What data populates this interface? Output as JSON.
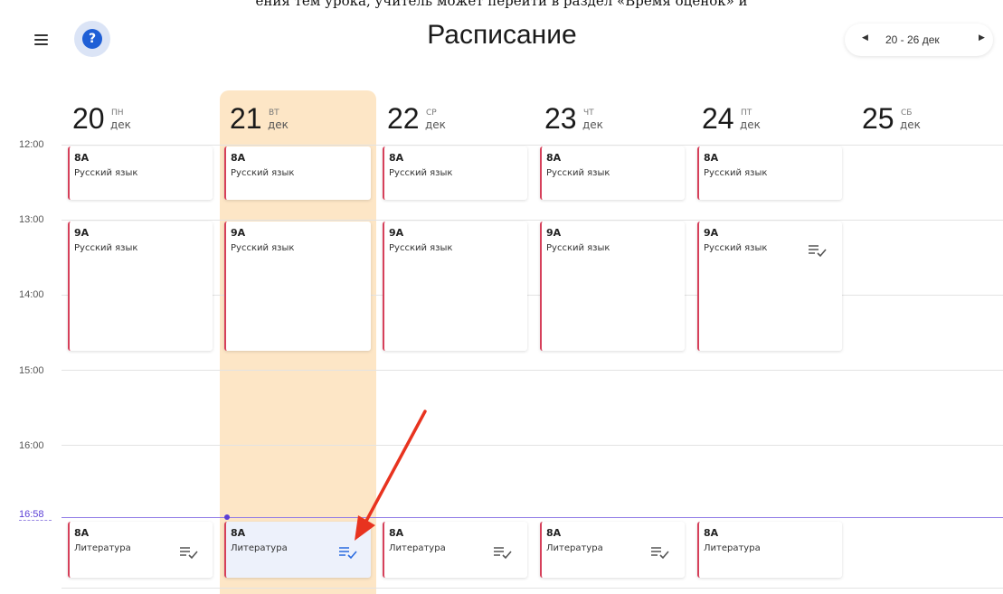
{
  "caption": "ения тем урока, учитель может перейти в раздел «Время оценок» и",
  "header": {
    "title": "Расписание",
    "week_range": "20 - 26 дек",
    "prev": "‹",
    "next": "›",
    "help_glyph": "?"
  },
  "days": [
    {
      "num": "20",
      "weekday": "ПН",
      "month": "дек"
    },
    {
      "num": "21",
      "weekday": "ВТ",
      "month": "дек"
    },
    {
      "num": "22",
      "weekday": "СР",
      "month": "дек"
    },
    {
      "num": "23",
      "weekday": "ЧТ",
      "month": "дек"
    },
    {
      "num": "24",
      "weekday": "ПТ",
      "month": "дек"
    },
    {
      "num": "25",
      "weekday": "СБ",
      "month": "дек"
    }
  ],
  "times": [
    "12:00",
    "13:00",
    "14:00",
    "15:00",
    "16:00"
  ],
  "now_time": "16:58",
  "lessons": {
    "row1": [
      {
        "cls": "8А",
        "subject": "Русский язык"
      },
      {
        "cls": "8А",
        "subject": "Русский язык"
      },
      {
        "cls": "8А",
        "subject": "Русский язык"
      },
      {
        "cls": "8А",
        "subject": "Русский язык"
      },
      {
        "cls": "8А",
        "subject": "Русский язык"
      }
    ],
    "row2": [
      {
        "cls": "9А",
        "subject": "Русский язык"
      },
      {
        "cls": "9А",
        "subject": "Русский язык"
      },
      {
        "cls": "9А",
        "subject": "Русский язык"
      },
      {
        "cls": "9А",
        "subject": "Русский язык"
      },
      {
        "cls": "9А",
        "subject": "Русский язык"
      }
    ],
    "row3": [
      {
        "cls": "8А",
        "subject": "Литература"
      },
      {
        "cls": "8А",
        "subject": "Литература"
      },
      {
        "cls": "8А",
        "subject": "Литература"
      },
      {
        "cls": "8А",
        "subject": "Литература"
      },
      {
        "cls": "8А",
        "subject": "Литература"
      }
    ]
  },
  "icons": {
    "menu": "menu-icon",
    "help": "help-icon",
    "homework": "homework-check-icon",
    "pointer": "red-arrow"
  },
  "colors": {
    "today_column": "#fde6c6",
    "lesson_accent": "#d6405a",
    "now_line": "#8f7ae6",
    "selected_icon": "#2a6be0",
    "arrow": "#e8331f"
  }
}
